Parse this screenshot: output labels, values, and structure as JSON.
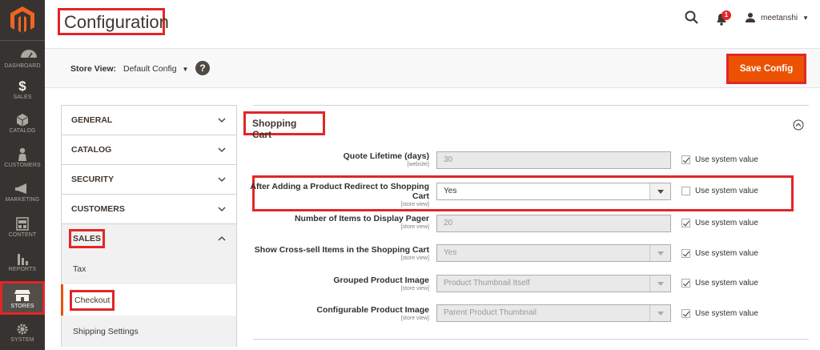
{
  "nav": {
    "items": [
      {
        "label": "DASHBOARD",
        "icon": "gauge-icon"
      },
      {
        "label": "SALES",
        "icon": "dollar-icon"
      },
      {
        "label": "CATALOG",
        "icon": "box-icon"
      },
      {
        "label": "CUSTOMERS",
        "icon": "person-icon"
      },
      {
        "label": "MARKETING",
        "icon": "megaphone-icon"
      },
      {
        "label": "CONTENT",
        "icon": "layout-icon"
      },
      {
        "label": "REPORTS",
        "icon": "bar-chart-icon"
      },
      {
        "label": "STORES",
        "icon": "shop-icon"
      },
      {
        "label": "SYSTEM",
        "icon": "gear-icon"
      }
    ],
    "active": "STORES"
  },
  "header": {
    "title": "Configuration",
    "notification_count": "1",
    "username": "meetanshi"
  },
  "store_bar": {
    "label": "Store View:",
    "value": "Default Config",
    "save_label": "Save Config"
  },
  "tabs": {
    "general": "GENERAL",
    "catalog": "CATALOG",
    "security": "SECURITY",
    "customers": "CUSTOMERS",
    "sales": "SALES",
    "sales_items": [
      "Tax",
      "Checkout",
      "Shipping Settings"
    ]
  },
  "section": {
    "title": "Shopping Cart",
    "rows": [
      {
        "label": "Quote Lifetime (days)",
        "scope": "[website]",
        "value": "30",
        "use_system": "Use system value",
        "checked": true
      },
      {
        "label_line1": "After Adding a Product Redirect to Shopping",
        "label_line2": "Cart",
        "scope": "[store view]",
        "value": "Yes",
        "use_system": "Use system value",
        "checked": false
      },
      {
        "label": "Number of Items to Display Pager",
        "scope": "[store view]",
        "value": "20",
        "use_system": "Use system value",
        "checked": true
      },
      {
        "label": "Show Cross-sell Items in the Shopping Cart",
        "scope": "[store view]",
        "value": "Yes",
        "use_system": "Use system value",
        "checked": true
      },
      {
        "label": "Grouped Product Image",
        "scope": "[store view]",
        "value": "Product Thumbnail Itself",
        "use_system": "Use system value",
        "checked": true
      },
      {
        "label": "Configurable Product Image",
        "scope": "[store view]",
        "value": "Parent Product Thumbnail",
        "use_system": "Use system value",
        "checked": true
      }
    ]
  },
  "colors": {
    "accent": "#eb5202",
    "highlight": "#e22626",
    "nav_bg": "#373330"
  }
}
